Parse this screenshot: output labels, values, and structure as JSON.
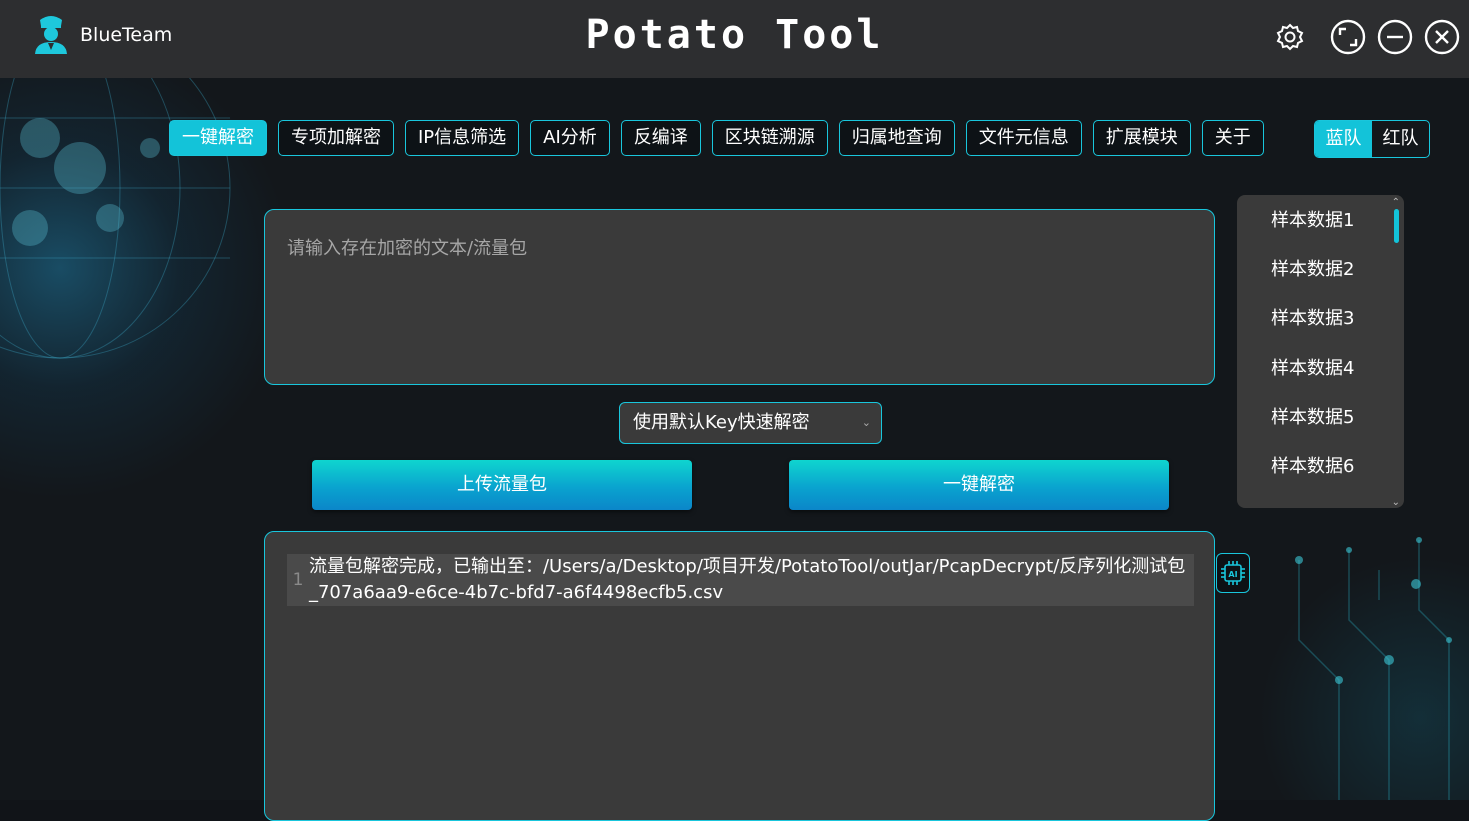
{
  "header": {
    "user_name": "BlueTeam",
    "app_title": "Potato Tool",
    "icons": [
      "user-police-icon",
      "gear-icon",
      "restore-window-icon",
      "minimize-icon",
      "close-icon"
    ]
  },
  "tabs": [
    {
      "label": "一键解密",
      "active": true
    },
    {
      "label": "专项加解密"
    },
    {
      "label": "IP信息筛选"
    },
    {
      "label": "AI分析"
    },
    {
      "label": "反编译"
    },
    {
      "label": "区块链溯源"
    },
    {
      "label": "归属地查询"
    },
    {
      "label": "文件元信息"
    },
    {
      "label": "扩展模块"
    },
    {
      "label": "关于"
    }
  ],
  "team_toggle": {
    "blue": "蓝队",
    "red": "红队",
    "active": "蓝队"
  },
  "input": {
    "placeholder": "请输入存在加密的文本/流量包"
  },
  "samples": [
    "样本数据1",
    "样本数据2",
    "样本数据3",
    "样本数据4",
    "样本数据5",
    "样本数据6"
  ],
  "decrypt_mode": {
    "selected": "使用默认Key快速解密"
  },
  "buttons": {
    "upload": "上传流量包",
    "decrypt": "一键解密"
  },
  "output": {
    "line_number": "1",
    "text": "流量包解密完成，已输出至：/Users/a/Desktop/项目开发/PotatoTool/outJar/PcapDecrypt/反序列化测试包_707a6aa9-e6ce-4b7c-bfd7-a6f4498ecfb5.csv"
  },
  "colors": {
    "accent": "#13c3d9",
    "panel": "#3a3a3a",
    "titlebar": "#2d2e30"
  }
}
